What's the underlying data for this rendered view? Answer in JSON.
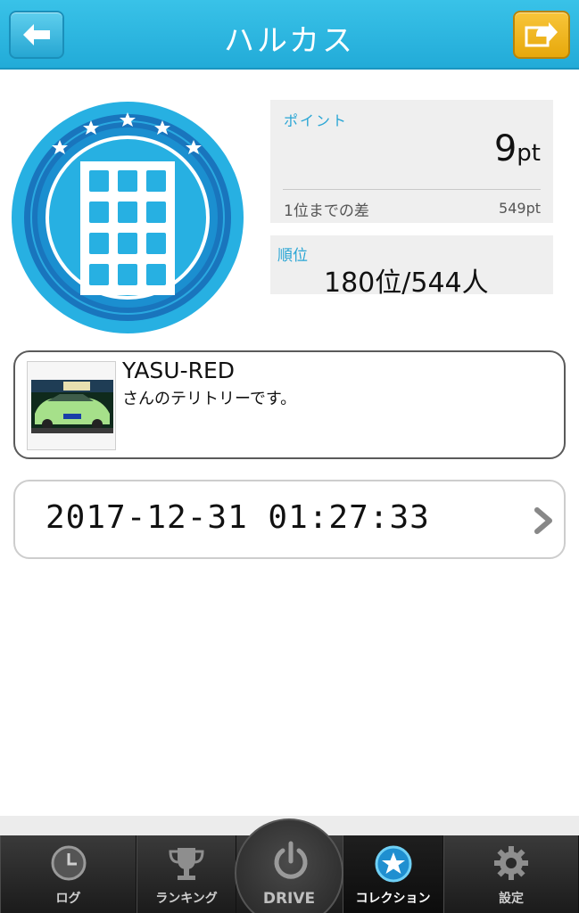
{
  "header": {
    "title": "ハルカス",
    "back_icon": "arrow-left-icon",
    "share_icon": "share-arrow-icon"
  },
  "badge": {
    "icon": "building-badge-icon"
  },
  "points": {
    "label": "ポイント",
    "value": "9",
    "unit": "pt",
    "diff_label": "1位までの差",
    "diff_value": "549pt"
  },
  "rank": {
    "label": "順位",
    "value": "180位/544人"
  },
  "territory": {
    "owner": "YASU-RED",
    "message": "さんのテリトリーです。"
  },
  "visit": {
    "datetime": "2017-12-31 01:27:33"
  },
  "tabs": [
    {
      "label": "ログ",
      "icon": "clock-icon"
    },
    {
      "label": "ランキング",
      "icon": "trophy-icon"
    },
    {
      "label": "DRIVE",
      "icon": "power-icon"
    },
    {
      "label": "コレクション",
      "icon": "star-circle-icon"
    },
    {
      "label": "設定",
      "icon": "gear-icon"
    }
  ],
  "colors": {
    "accent": "#2aa6d5",
    "header": "#22abd8",
    "share": "#f0b51c"
  }
}
